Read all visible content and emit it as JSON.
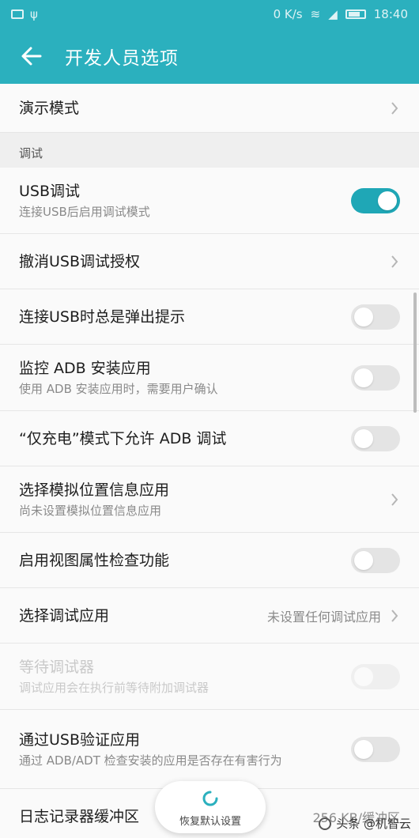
{
  "status_bar": {
    "network_speed": "0 K/s",
    "time": "18:40"
  },
  "app_bar": {
    "title": "开发人员选项"
  },
  "rows_top": {
    "demo_mode": "演示模式"
  },
  "section": {
    "debug": "调试"
  },
  "items": {
    "usb_debug": {
      "title": "USB调试",
      "subtitle": "连接USB后启用调试模式",
      "enabled": true
    },
    "revoke_usb": {
      "title": "撤消USB调试授权"
    },
    "usb_prompt": {
      "title": "连接USB时总是弹出提示",
      "enabled": false
    },
    "monitor_adb": {
      "title": "监控 ADB 安装应用",
      "subtitle": "使用 ADB 安装应用时，需要用户确认",
      "enabled": false
    },
    "charge_adb": {
      "title": "“仅充电”模式下允许 ADB 调试",
      "enabled": false
    },
    "mock_location": {
      "title": "选择模拟位置信息应用",
      "subtitle": "尚未设置模拟位置信息应用"
    },
    "view_attr": {
      "title": "启用视图属性检查功能",
      "enabled": false
    },
    "debug_app": {
      "title": "选择调试应用",
      "value": "未设置任何调试应用"
    },
    "wait_debugger": {
      "title": "等待调试器",
      "subtitle": "调试应用会在执行前等待附加调试器",
      "enabled": false,
      "disabled": true
    },
    "verify_usb": {
      "title": "通过USB验证应用",
      "subtitle": "通过 ADB/ADT 检查安装的应用是否存在有害行为",
      "enabled": false
    },
    "logger_buffer": {
      "title": "日志记录器缓冲区",
      "value": "256 KB/缓冲区"
    }
  },
  "floating": {
    "label": "恢复默认设置"
  },
  "watermark": {
    "text": "头条 @机智云"
  },
  "colors": {
    "accent": "#2bb0be",
    "toggle_on": "#1fa7b6"
  }
}
